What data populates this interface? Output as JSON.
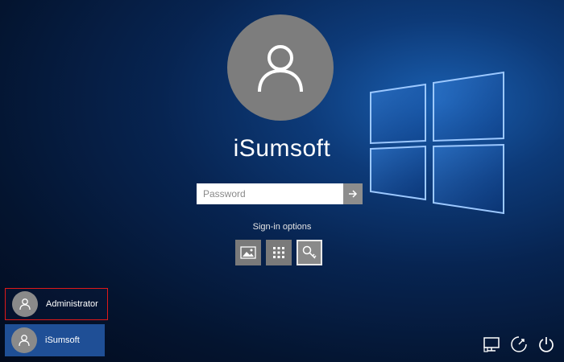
{
  "user": {
    "name": "iSumsoft"
  },
  "password": {
    "placeholder": "Password"
  },
  "signin": {
    "label": "Sign-in options",
    "options": [
      {
        "icon": "picture-password-icon"
      },
      {
        "icon": "pin-icon"
      },
      {
        "icon": "key-icon",
        "selected": true
      }
    ]
  },
  "accounts": [
    {
      "name": "Administrator",
      "highlighted": true
    },
    {
      "name": "iSumsoft",
      "selected": true
    }
  ],
  "system": {
    "icons": [
      "network-icon",
      "ease-of-access-icon",
      "power-icon"
    ]
  },
  "colors": {
    "accent": "#1f4f96",
    "highlight_border": "#e01919",
    "avatar_gray": "#7d7d7d"
  }
}
